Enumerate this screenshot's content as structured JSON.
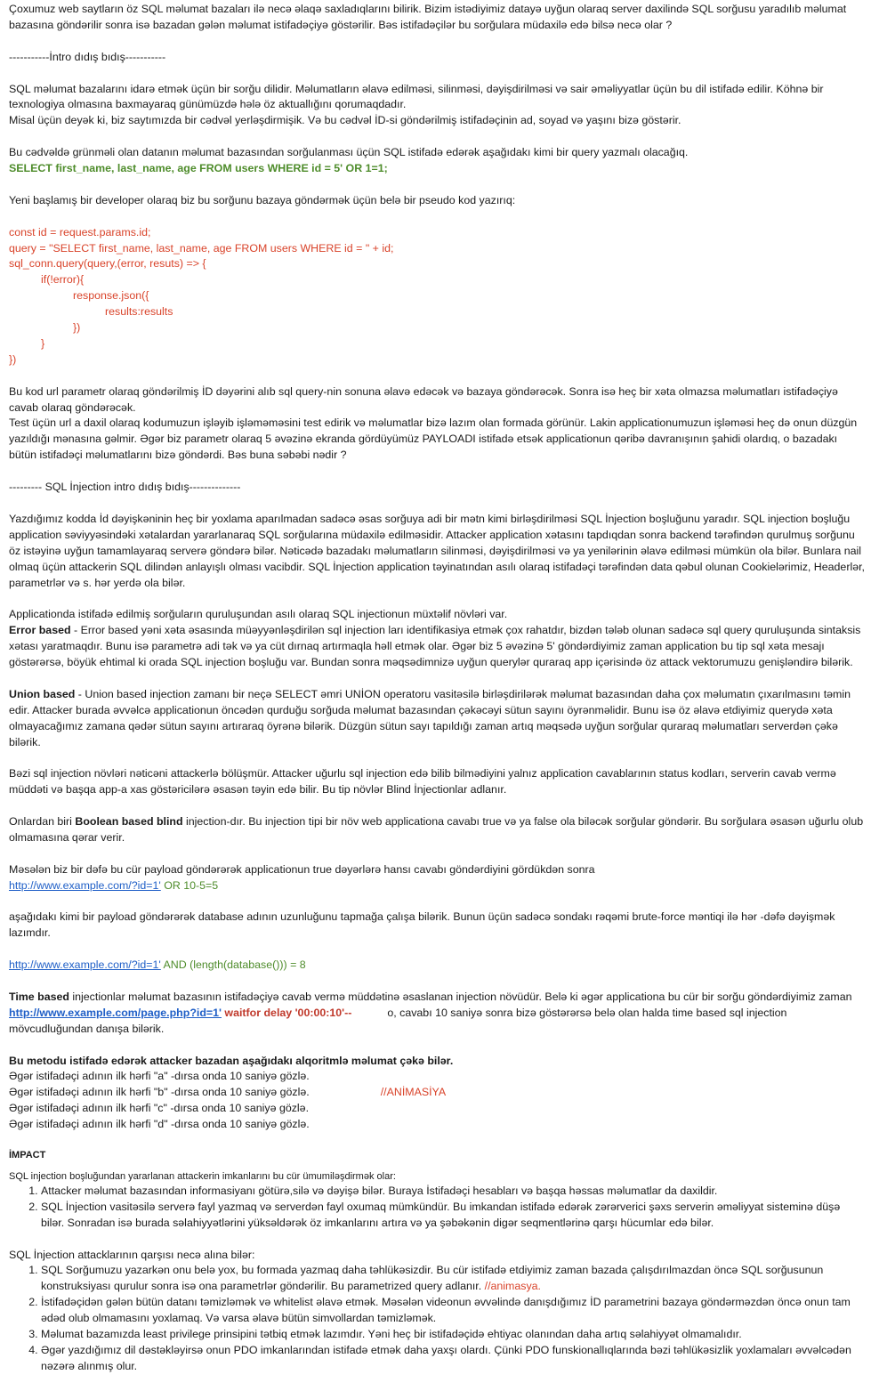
{
  "p1": "Çoxumuz web saytların öz SQL məlumat bazaları ilə necə əlaqə saxladıqlarını bilirik. Bizim istədiyimiz datayə uyğun olaraq server daxilində SQL sorğusu yaradılıb məlumat bazasına göndərilir sonra isə bazadan gələn məlumat istifadəçiyə göstərilir. Bəs istifadəçilər bu sorğulara müdaxilə edə bilsə necə olar ?",
  "sep1": "-----------İntro  dıdış bıdış-----------",
  "p2": "SQL məlumat bazalarını idarə etmək üçün bir sorğu dilidir. Məlumatların əlavə edilməsi, silinməsi, dəyişdirilməsi və sair əməliyyatlar üçün bu dil istifadə edilir. Köhnə bir texnologiya olmasına baxmayaraq günümüzdə hələ öz aktuallığını qorumaqdadır.",
  "p3": "Misal üçün deyək ki, biz saytımızda bir cədvəl yerləşdirmişik. Və bu cədvəl İD-si göndərilmiş istifadəçinin ad, soyad və yaşını bizə göstərir.",
  "p4": "Bu cədvəldə grünməli olan datanın məlumat bazasından sorğulanması üçün SQL istifadə edərək aşağıdakı kimi bir query yazmalı olacağıq.",
  "query1": "SELECT first_name, last_name, age FROM users WHERE id = 5' OR 1=1;",
  "p5": "Yeni başlamış bir developer olaraq biz bu sorğunu bazaya göndərmək üçün belə bir pseudo kod yazırıq:",
  "code": [
    "const id = request.params.id;",
    "query = \"SELECT first_name, last_name, age FROM users WHERE id = \" + id;",
    "sql_conn.query(query,(error, resuts) => {",
    "\tif(!error){",
    "\t\tresponse.json({",
    "\t\t\tresults:results",
    "\t\t})",
    "\t}",
    "})"
  ],
  "p6": "Bu kod url parametr olaraq göndərilmiş İD dəyərini alıb sql query-nin sonuna əlavə edəcək və bazaya göndərəcək. Sonra isə heç bir xəta olmazsa məlumatları istifadəçiyə cavab olaraq göndərəcək.",
  "p7": "Test üçün url a daxil olaraq kodumuzun işləyib işləməməsini test edirik və məlumatlar bizə lazım olan formada görünür. Lakin applicationumuzun işləməsi heç də onun düzgün yazıldığı mənasına gəlmir. Əgər biz parametr olaraq 5 əvəzinə ekranda gördüyümüz PAYLOADI istifadə etsək applicationun qəribə davranışının şahidi olardıq, o bazadakı bütün istifadəçi məlumatlarını bizə göndərdi. Bəs buna səbəbi nədir ?",
  "sep2": "--------- SQL İnjection intro dıdış bıdış--------------",
  "p8": "Yazdığımız kodda İd dəyişkəninin heç bir yoxlama aparılmadan sadəcə əsas sorğuya adi bir mətn kimi birləşdirilməsi SQL İnjection boşluğunu yaradır. SQL injection boşluğu application səviyyəsindəki xətalardan yararlanaraq SQL sorğularına müdaxilə edilməsidir. Attacker application xətasını tapdıqdan sonra backend tərəfindən qurulmuş sorğunu öz istəyinə uyğun tamamlayaraq serverə göndərə bilər. Nəticədə bazadakı məlumatların silinməsi, dəyişdirilməsi və ya yenilərinin əlavə edilməsi mümkün ola bilər. Bunlara nail olmaq üçün attackerin SQL dilindən anlayışlı olması vacibdir. SQL İnjection application təyinatından asılı olaraq istifadəçi tərəfindən data qəbul olunan  Cookielərimiz, Headerlər, parametrlər və s. hər yerdə ola bilər.",
  "p9": "Applicationda istifadə edilmiş sorğuların quruluşundan asılı olaraq SQL injectionun müxtəlif növləri var.",
  "error_label": "Error based",
  "p10": " - Error based yəni xəta əsasında müəyyənləşdirilən sql injection ları identifikasiya etmək çox rahatdır, bizdən tələb olunan sadəcə sql query quruluşunda sintaksis xətası yaratmaqdır. Bunu isə parametrə adi tək və ya cüt dırnaq artırmaqla həll etmək olar. Əgər biz 5 əvəzinə 5' göndərdiyimiz zaman application bu tip sql xəta mesajı göstərərsə, böyük ehtimal ki orada SQL injection boşluğu var. Bundan sonra məqsədimnizə uyğun querylər quraraq app içərisində öz attack vektorumuzu genişləndirə bilərik.",
  "union_label": "Union based",
  "p11": " - Union based injection zamanı bir neçə SELECT əmri UNİON operatoru vasitəsilə birləşdirilərək məlumat bazasından daha çox məlumatın çıxarılmasını təmin edir. Attacker burada əvvəlcə applicationun öncədən qurduğu sorğuda məlumat bazasından çəkəcəyi sütun sayını öyrənməlidir. Bunu isə öz əlavə etdiyimiz querydə xəta olmayacağımız zamana qədər sütun sayını artıraraq öyrənə bilərik.  Düzgün sütun sayı tapıldığı zaman artıq məqsədə uyğun sorğular quraraq məlumatları serverdən çəkə bilərik.",
  "p12": "Bəzi sql injection növləri nəticəni attackerlə bölüşmür. Attacker uğurlu sql injection edə bilib bilmədiyini yalnız application cavablarının status kodları, serverin cavab vermə müddəti və başqa app-a xas göstəricilərə əsasən təyin edə bilir. Bu tip növlər Blind İnjectionlar adlanır.",
  "p13a": "Onlardan biri ",
  "boolean_label": "Boolean based blind",
  "p13b": " injection-dır. Bu injection tipi bir növ web applicationa cavabı true və ya false ola biləcək sorğular göndərir. Bu sorğulara əsasən uğurlu olub olmamasına qərar verir.",
  "p14": "Məsələn biz bir dəfə bu cür payload göndərərək applicationun true dəyərlərə hansı cavabı göndərdiyini gördükdən sonra",
  "url1": "http://www.example.com/?id=1'",
  "payload1": " OR 10-5=5",
  "p15": "aşağıdakı kimi bir payload göndərərək database adının uzunluğunu tapmağa çalışa bilərik. Bunun üçün sadəcə sondakı rəqəmi brute-force məntiqi ilə hər -dəfə dəyişmək lazımdır.",
  "url2": "http://www.example.com/?id=1'",
  "payload2": " AND (length(database())) = 8",
  "time_label": "Time based",
  "p16a": " injectionlar məlumat bazasının istifadəçiyə cavab vermə müddətinə əsaslanan injection növüdür. Belə ki əgər applicationa bu cür bir sorğu göndərdiyimiz zaman ",
  "url3": "http://www.example.com/page.php?id=1'",
  "payload3": " waitfor delay '00:00:10'--",
  "p16b": "o, cavabı 10 saniyə sonra bizə göstərərsə belə olan halda time based sql injection mövcudluğundan danışa bilərik.",
  "algo_title": "Bu metodu istifadə edərək attacker bazadan aşağıdakı alqoritmlə məlumat çəkə bilər.",
  "algo": [
    "Əgər istifadəçi adının ilk hərfi \"a\" -dırsa onda 10 saniyə gözlə.",
    "Əgər istifadəçi adının ilk hərfi \"b\" -dırsa onda 10 saniyə gözlə.",
    "Əgər istifadəçi adının ilk hərfi \"c\" -dırsa onda 10 saniyə gözlə.",
    "Əgər istifadəçi adının ilk hərfi \"d\" -dırsa onda 10 saniyə gözlə."
  ],
  "anim1": "//ANİMASİYA",
  "impact_title": "İMPACT",
  "impact_intro": "SQL injection boşluğundan yararlanan attackerin imkanlarını bu cür ümumiləşdirmək olar:",
  "impact_items": [
    "Attacker məlumat bazasından informasiyanı götürə,silə və dəyişə bilər. Buraya İstifadəçi hesabları və başqa həssas məlumatlar da daxildir.",
    "SQL İnjection vasitəsilə serverə fayl yazmaq və serverdən fayl oxumaq mümkündür. Bu imkandan istifadə edərək zərərverici şəxs serverin əməliyyat sisteminə düşə bilər.  Sonradan isə burada səlahiyyətlərini yüksəldərək öz imkanlarını artıra və ya şəbəkənin digər seqmentlərinə qarşı hücumlar edə bilər."
  ],
  "prevent_title": "SQL İnjection attacklarının qarşısı necə alına bilər:",
  "prevent_1": "SQL Sorğumuzu yazarkən onu belə yox, bu formada yazmaq daha təhlükəsizdir. Bu cür istifadə etdiyimiz zaman bazada çalışdırılmazdan öncə SQL sorğusunun konstruksiyası qurulur sonra isə ona parametrlər göndərilir. Bu parametrized query adlanır. ",
  "anim2": "//animasya.",
  "prevent_items": [
    "İstifadəçidən gələn bütün datanı təmizləmək və whitelist əlavə etmək. Məsələn videonun əvvəlində danışdığımız İD parametrini bazaya göndərməzdən öncə onun tam ədəd olub olmamasını yoxlamaq. Və varsa əlavə bütün simvollardan təmizləmək.",
    "Məlumat bazamızda least privilege prinsipini tətbiq etmək lazımdır. Yəni heç bir istifadəçidə ehtiyac olanından daha artıq səlahiyyət olmamalıdır.",
    "Əgər yazdığımız dil dəstəkləyirsə onun PDO imkanlarından istifadə etmək daha yaxşı olardı. Çünki PDO funskionallıqlarında bəzi təhlükəsizlik yoxlamaları əvvəlcədən nəzərə alınmış olur."
  ]
}
